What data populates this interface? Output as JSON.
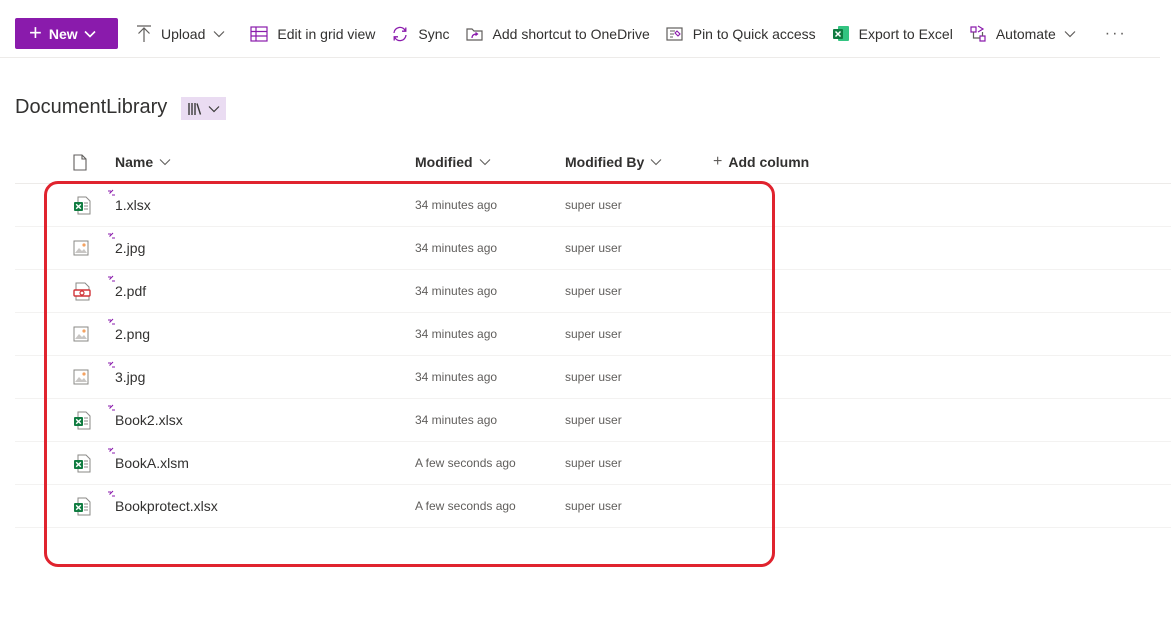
{
  "toolbar": {
    "new_label": "New",
    "commands": [
      {
        "label": "Upload",
        "icon": "upload-icon",
        "dropdown": true
      },
      {
        "label": "Edit in grid view",
        "icon": "grid-icon",
        "dropdown": false
      },
      {
        "label": "Sync",
        "icon": "sync-icon",
        "dropdown": false
      },
      {
        "label": "Add shortcut to OneDrive",
        "icon": "shortcut-icon",
        "dropdown": false
      },
      {
        "label": "Pin to Quick access",
        "icon": "pin-icon",
        "dropdown": false
      },
      {
        "label": "Export to Excel",
        "icon": "excel-icon",
        "dropdown": false
      },
      {
        "label": "Automate",
        "icon": "automate-icon",
        "dropdown": true
      }
    ],
    "more_label": "···"
  },
  "library": {
    "title": "DocumentLibrary",
    "view_icon": "library-view-icon"
  },
  "columns": {
    "name": "Name",
    "modified": "Modified",
    "modified_by": "Modified By",
    "add_column": "Add column"
  },
  "files": [
    {
      "name": "1.xlsx",
      "type": "excel",
      "modified": "34 minutes ago",
      "modified_by": "super user"
    },
    {
      "name": "2.jpg",
      "type": "image",
      "modified": "34 minutes ago",
      "modified_by": "super user"
    },
    {
      "name": "2.pdf",
      "type": "pdf",
      "modified": "34 minutes ago",
      "modified_by": "super user"
    },
    {
      "name": "2.png",
      "type": "image",
      "modified": "34 minutes ago",
      "modified_by": "super user"
    },
    {
      "name": "3.jpg",
      "type": "image",
      "modified": "34 minutes ago",
      "modified_by": "super user"
    },
    {
      "name": "Book2.xlsx",
      "type": "excel",
      "modified": "34 minutes ago",
      "modified_by": "super user"
    },
    {
      "name": "BookA.xlsm",
      "type": "excel",
      "modified": "A few seconds ago",
      "modified_by": "super user"
    },
    {
      "name": "Bookprotect.xlsx",
      "type": "excel",
      "modified": "A few seconds ago",
      "modified_by": "super user"
    }
  ],
  "colors": {
    "accent": "#8a1bac",
    "excel": "#107c41",
    "pdf": "#d13438",
    "highlight": "#e0232e",
    "new_mark": "#8a1bac"
  }
}
